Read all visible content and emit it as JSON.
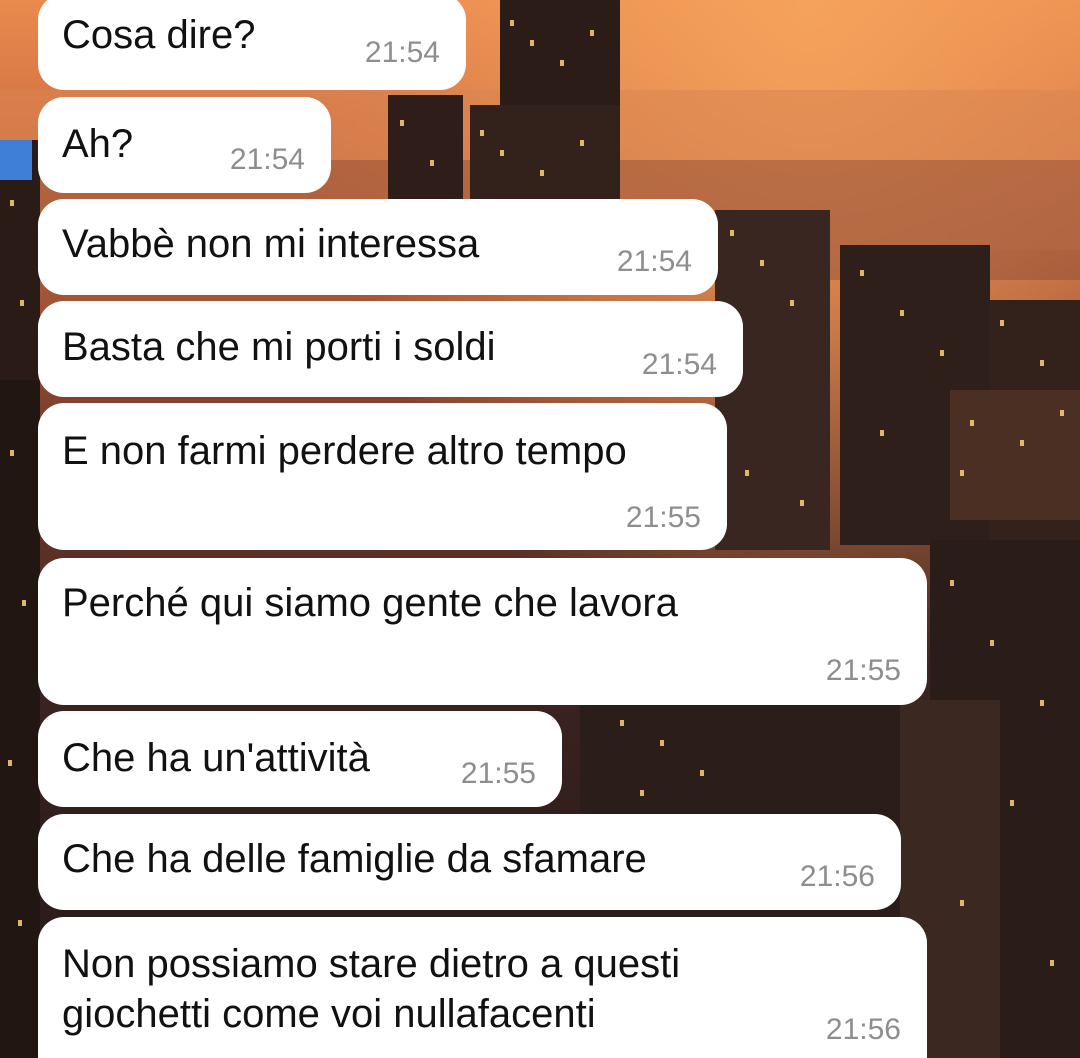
{
  "wallpaper": {
    "description_icon": "city-skyline",
    "colors": {
      "sky_top": "#e98a4e",
      "sky_glow": "#f5a25c",
      "haze": "#c7673f",
      "city_dark": "#241816",
      "window_light": "#ffd27a"
    }
  },
  "bubble_color": "#ffffff",
  "text_color": "#111111",
  "time_color": "#8e8e8e",
  "messages": [
    {
      "text": "Cosa dire?",
      "time": "21:54"
    },
    {
      "text": "Ah?",
      "time": "21:54"
    },
    {
      "text": "Vabbè non mi interessa",
      "time": "21:54"
    },
    {
      "text": "Basta che mi porti i soldi",
      "time": "21:54"
    },
    {
      "text": "E non farmi perdere altro tempo",
      "time": "21:55"
    },
    {
      "text": "Perché qui siamo gente che lavora",
      "time": "21:55"
    },
    {
      "text": "Che ha un'attività",
      "time": "21:55"
    },
    {
      "text": "Che ha delle famiglie da sfamare",
      "time": "21:56"
    },
    {
      "text": "Non possiamo stare dietro a questi giochetti come voi nullafacenti",
      "time": "21:56"
    }
  ]
}
